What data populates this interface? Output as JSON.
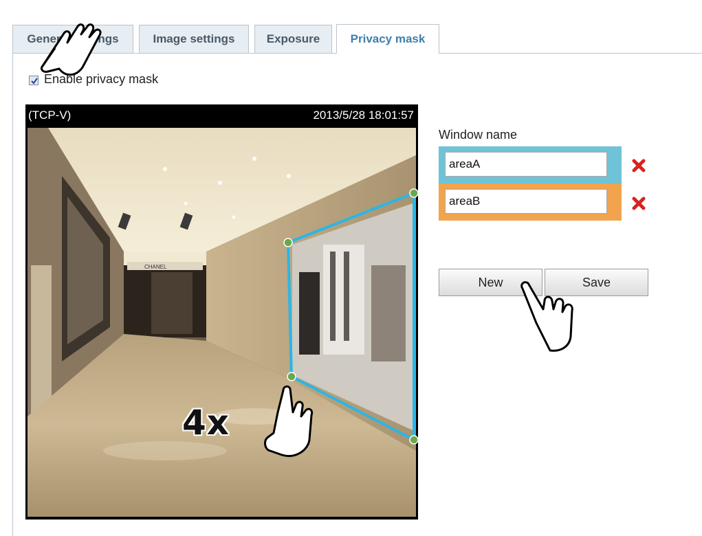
{
  "tabs": [
    {
      "label": "General settings",
      "active": false
    },
    {
      "label": "Image settings",
      "active": false
    },
    {
      "label": "Exposure",
      "active": false
    },
    {
      "label": "Privacy mask",
      "active": true
    }
  ],
  "enable": {
    "label": "Enable privacy mask",
    "checked": true
  },
  "video": {
    "stream": "(TCP-V)",
    "timestamp": "2013/5/28 18:01:57",
    "store_sign": "CHANEL"
  },
  "window_panel": {
    "label": "Window name",
    "areas": [
      {
        "name": "areaA",
        "color": "#6fc3d6"
      },
      {
        "name": "areaB",
        "color": "#f2a34d"
      }
    ]
  },
  "buttons": {
    "new": "New",
    "save": "Save"
  },
  "annotation": {
    "repeat": "4x"
  },
  "colors": {
    "mask_outline": "#2ab6e6",
    "mask_vertex": "#6aa84f",
    "delete": "#d9231f",
    "active_tab": "#3f7fa9"
  },
  "icons": {
    "delete": "close-icon",
    "pointer": "hand-pointer-icon"
  }
}
